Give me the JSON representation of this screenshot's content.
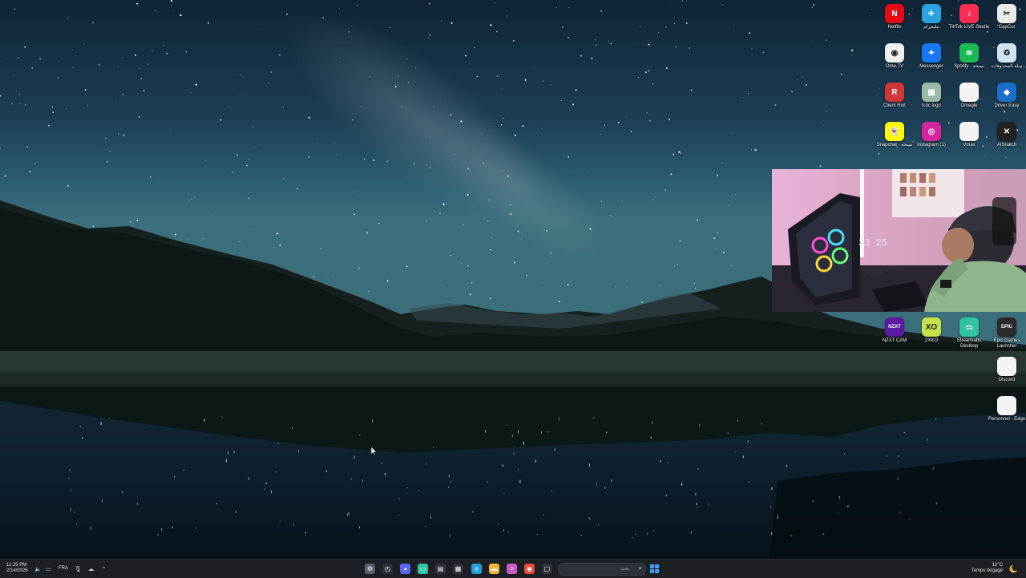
{
  "desktop": {
    "icons": [
      {
        "label": "Netflix",
        "icon": "netflix-icon",
        "color": "#e50914",
        "glyph": "N"
      },
      {
        "label": "تيليجرام",
        "icon": "telegram-icon",
        "color": "#2aa3e0",
        "glyph": "✈"
      },
      {
        "label": "TikTok LIVE Studio",
        "icon": "tiktok-live-icon",
        "color": "#fe2c55",
        "glyph": "♪"
      },
      {
        "label": "CapCut",
        "icon": "capcut-icon",
        "color": "#eaeaea",
        "glyph": "✂"
      },
      {
        "label": "Ome.TV",
        "icon": "ometv-icon",
        "color": "#f0f0f0",
        "glyph": "◉"
      },
      {
        "label": "Messenger",
        "icon": "messenger-icon",
        "color": "#1877f2",
        "glyph": "✦"
      },
      {
        "label": "Spotify - نسخة",
        "icon": "spotify-icon",
        "color": "#1db954",
        "glyph": "≋"
      },
      {
        "label": "سلة المحذوفات",
        "icon": "recycle-bin-icon",
        "color": "#cfe3f0",
        "glyph": "♻"
      },
      {
        "label": "Client Riot",
        "icon": "riot-client-icon",
        "color": "#d13639",
        "glyph": "R"
      },
      {
        "label": "lcdc logo",
        "icon": "image-file-icon",
        "color": "#9bb8a8",
        "glyph": "▣"
      },
      {
        "label": "Omegle",
        "icon": "blank-file-icon",
        "color": "#f4f4f4",
        "glyph": ""
      },
      {
        "label": "Driver Easy",
        "icon": "driver-easy-icon",
        "color": "#1b6fc9",
        "glyph": "◆"
      },
      {
        "label": "Snapchat - نسخة",
        "icon": "snapchat-icon",
        "color": "#fffc00",
        "glyph": "👻"
      },
      {
        "label": "Instagram (1)",
        "icon": "instagram-icon",
        "color": "#d6249f",
        "glyph": "◎"
      },
      {
        "label": "Vmax",
        "icon": "blank-file-icon",
        "color": "#f4f4f4",
        "glyph": ""
      },
      {
        "label": "AISnatch",
        "icon": "aisnatch-icon",
        "color": "#222222",
        "glyph": "✕"
      },
      {
        "label": "NZXT CAM",
        "icon": "nzxt-cam-icon",
        "color": "#5a1aa0",
        "glyph": "NZXT"
      },
      {
        "label": "2XKO",
        "icon": "2xko-icon",
        "color": "#c6e04a",
        "glyph": "XO"
      },
      {
        "label": "Streamlabs Desktop",
        "icon": "streamlabs-icon",
        "color": "#31c3a2",
        "glyph": "▭"
      },
      {
        "label": "Epic Games Launcher",
        "icon": "epic-games-icon",
        "color": "#2a2a2a",
        "glyph": "EPIC"
      },
      {
        "label": "Discord",
        "icon": "blank-file-icon",
        "color": "#f4f4f4",
        "glyph": ""
      },
      {
        "label": "Personnel - Edge",
        "icon": "blank-file-icon",
        "color": "#f4f4f4",
        "glyph": ""
      }
    ]
  },
  "webcam": {
    "clock_text": "23 25"
  },
  "taskbar": {
    "time": "11:25 PM",
    "date": "2/14/2026",
    "language": "FRA",
    "search_placeholder": "بحث",
    "weather_temp": "12°C",
    "weather_desc": "Temps dégagé",
    "apps": [
      {
        "name": "settings-icon",
        "color": "#5a6270",
        "glyph": "⚙"
      },
      {
        "name": "clock-app-icon",
        "color": "#2d3139",
        "glyph": "◴"
      },
      {
        "name": "discord-icon",
        "color": "#5865f2",
        "glyph": "◕"
      },
      {
        "name": "streamlabs-taskbar-icon",
        "color": "#31c3a2",
        "glyph": "▭"
      },
      {
        "name": "terminal-icon",
        "color": "#2d3139",
        "glyph": "▤"
      },
      {
        "name": "calendar-icon",
        "color": "#2d3139",
        "glyph": "▦"
      },
      {
        "name": "edge-icon",
        "color": "#1fa0d8",
        "glyph": "e"
      },
      {
        "name": "file-explorer-icon",
        "color": "#f2b632",
        "glyph": "▬"
      },
      {
        "name": "copilot-icon",
        "color": "#c95ac7",
        "glyph": "✧"
      },
      {
        "name": "chrome-icon",
        "color": "#e14b3b",
        "glyph": "◉"
      },
      {
        "name": "window-icon",
        "color": "#2d3139",
        "glyph": "▢"
      }
    ]
  }
}
